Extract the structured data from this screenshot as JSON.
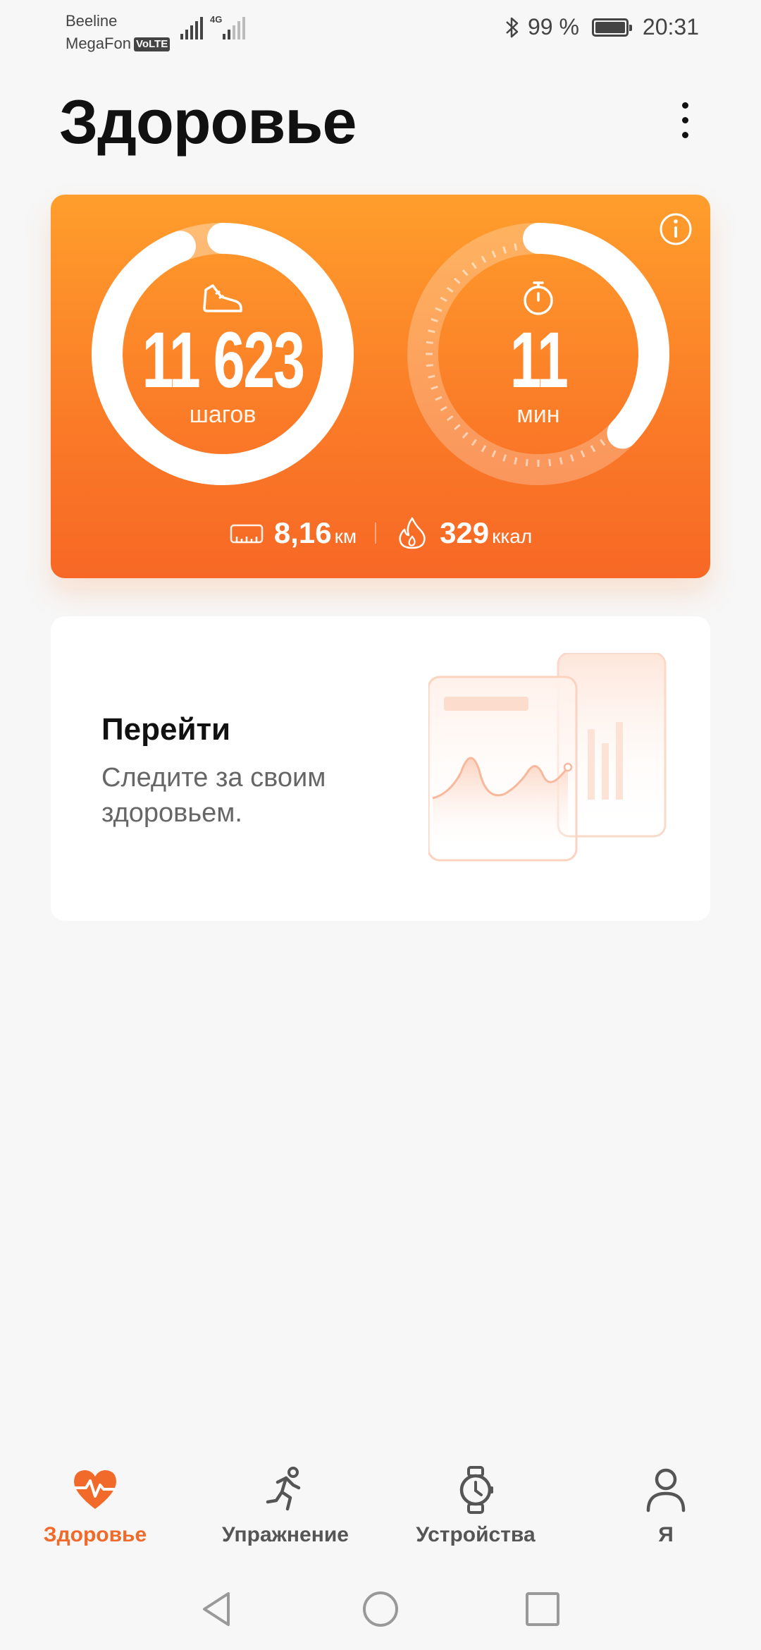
{
  "status_bar": {
    "carrier1": "Beeline",
    "carrier2": "MegaFon",
    "volte": "VoLTE",
    "network": "4G",
    "battery": "99 %",
    "time": "20:31"
  },
  "header": {
    "title": "Здоровье",
    "more_icon": "more-vertical-icon"
  },
  "activity": {
    "steps_value": "11 623",
    "steps_unit": "шагов",
    "steps_progress": 0.94,
    "time_value": "11",
    "time_unit": "мин",
    "time_progress": 0.37,
    "distance_value": "8,16",
    "distance_unit": "км",
    "calories_value": "329",
    "calories_unit": "ккал",
    "info_icon": "info-icon"
  },
  "promo": {
    "title": "Перейти",
    "text": "Следите за своим здоровьем."
  },
  "bottom_nav": {
    "items": [
      {
        "label": "Здоровье",
        "icon": "heart-icon",
        "active": true
      },
      {
        "label": "Упражнение",
        "icon": "running-icon",
        "active": false
      },
      {
        "label": "Устройства",
        "icon": "watch-icon",
        "active": false
      },
      {
        "label": "Я",
        "icon": "person-icon",
        "active": false
      }
    ]
  },
  "colors": {
    "accent": "#f26a2a",
    "card_top": "#ff9e2c",
    "card_bottom": "#f76826",
    "background": "#f7f7f7"
  }
}
